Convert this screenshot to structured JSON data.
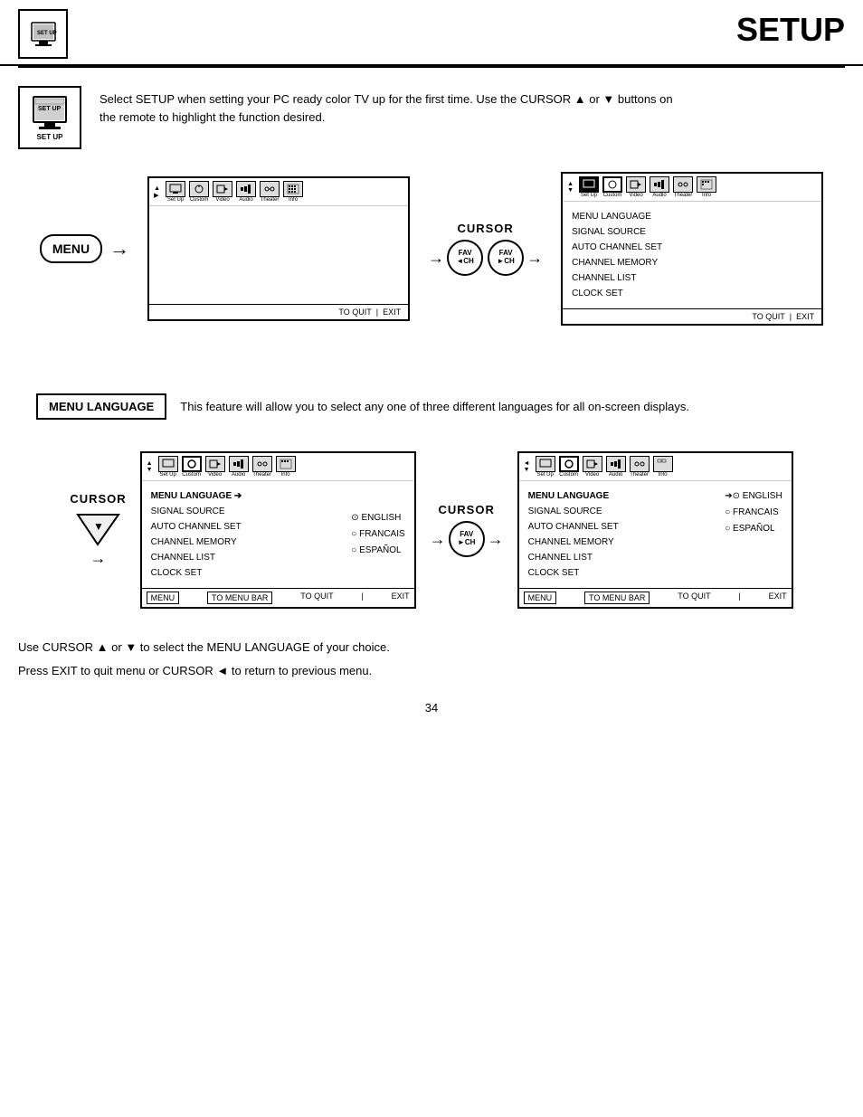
{
  "header": {
    "title": "SETUP",
    "icon_label": "SET UP"
  },
  "intro": {
    "text_line1": "Select SETUP when setting your PC ready color TV up for the first time.  Use the CURSOR ▲ or ▼ buttons on",
    "text_line2": "the remote to highlight the function desired."
  },
  "diagram1": {
    "menu_button": "MENU",
    "cursor_label": "CURSOR",
    "fav_left": "FAV\nCH",
    "fav_right": "FAV\nCH",
    "screen1": {
      "tabs": [
        "Set Up",
        "Custom",
        "Video",
        "Audio",
        "Theater",
        "Info"
      ],
      "footer": "TO QUIT   EXIT"
    },
    "screen2": {
      "tabs": [
        "Set Up",
        "Custom",
        "Video",
        "Audio",
        "Theater",
        "Info"
      ],
      "items": [
        "MENU LANGUAGE",
        "SIGNAL SOURCE",
        "AUTO CHANNEL SET",
        "CHANNEL MEMORY",
        "CHANNEL LIST",
        "CLOCK SET"
      ],
      "footer": "TO QUIT   EXIT"
    }
  },
  "section": {
    "label": "MENU LANGUAGE",
    "description": "This feature will allow you to select any one of three different languages for all on-screen displays."
  },
  "diagram2": {
    "cursor_label": "CURSOR",
    "cursor_symbol": "▼",
    "fav_label": "FAV\nCH",
    "screen1": {
      "tabs": [
        "Set Up",
        "Custom",
        "Video",
        "Audio",
        "Theater",
        "Info"
      ],
      "items": [
        "MENU LANGUAGE",
        "SIGNAL SOURCE",
        "AUTO CHANNEL SET",
        "CHANNEL MEMORY",
        "CHANNEL LIST",
        "CLOCK SET"
      ],
      "selected": "MENU LANGUAGE",
      "arrow": "➔",
      "lang_options": [
        "⊙ ENGLISH",
        "○ FRANCAIS",
        "○ ESPAÑOL"
      ],
      "footer_left": "MENU",
      "footer_mid": "TO MENU BAR",
      "footer_right": "TO QUIT   EXIT"
    },
    "cursor_label2": "CURSOR",
    "screen2": {
      "tabs": [
        "Set Up",
        "Custom",
        "Video",
        "Audio",
        "Theater",
        "Info"
      ],
      "items": [
        "MENU LANGUAGE",
        "SIGNAL SOURCE",
        "AUTO CHANNEL SET",
        "CHANNEL MEMORY",
        "CHANNEL LIST",
        "CLOCK SET"
      ],
      "selected": "MENU LANGUAGE",
      "arrow": "➔⊙",
      "lang_options": [
        "ENGLISH",
        "○ FRANCAIS",
        "○ ESPAÑOL"
      ],
      "footer_left": "MENU",
      "footer_mid": "TO MENU BAR",
      "footer_right": "TO QUIT   EXIT"
    }
  },
  "bottom_notes": {
    "line1": "Use CURSOR ▲ or ▼ to select the MENU LANGUAGE of your choice.",
    "line2": "Press EXIT to quit menu or CURSOR ◄ to return to previous menu."
  },
  "page_number": "34"
}
